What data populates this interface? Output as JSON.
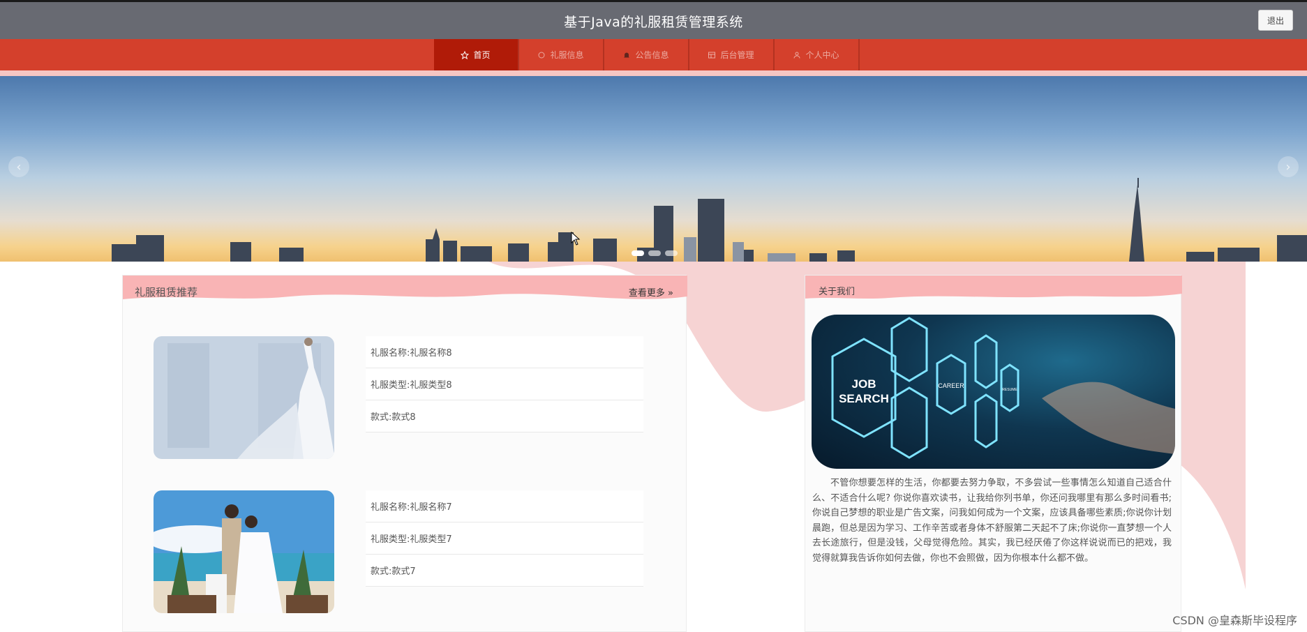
{
  "header": {
    "title": "基于Java的礼服租赁管理系统",
    "logout_label": "退出"
  },
  "nav": {
    "items": [
      {
        "label": "首页",
        "icon": "star-icon"
      },
      {
        "label": "礼服信息",
        "icon": "circle-icon"
      },
      {
        "label": "公告信息",
        "icon": "bell-icon"
      },
      {
        "label": "后台管理",
        "icon": "grid-icon"
      },
      {
        "label": "个人中心",
        "icon": "user-icon"
      }
    ]
  },
  "banner": {
    "prev_symbol": "‹",
    "next_symbol": "›",
    "slide_count": 3,
    "active_slide": 1
  },
  "recommend": {
    "title": "礼服租赁推荐",
    "more_label": "查看更多 »",
    "items": [
      {
        "name": "礼服名称:礼服名称8",
        "type": "礼服类型:礼服类型8",
        "style": "款式:款式8"
      },
      {
        "name": "礼服名称:礼服名称7",
        "type": "礼服类型:礼服类型7",
        "style": "款式:款式7"
      }
    ]
  },
  "about": {
    "title": "关于我们",
    "image_labels": {
      "job": "JOB",
      "search": "SEARCH",
      "career": "CAREER",
      "resume": "RESUME"
    },
    "text": "不管你想要怎样的生活，你都要去努力争取，不多尝试一些事情怎么知道自己适合什么、不适合什么呢? 你说你喜欢读书，让我给你列书单，你还问我哪里有那么多时间看书;你说自己梦想的职业是广告文案，问我如何成为一个文案，应该具备哪些素质;你说你计划晨跑，但总是因为学习、工作辛苦或者身体不舒服第二天起不了床;你说你一直梦想一个人去长途旅行，但是没钱，父母觉得危险。其实，我已经厌倦了你这样说说而已的把戏，我觉得就算我告诉你如何去做，你也不会照做，因为你根本什么都不做。"
  },
  "watermark": "CSDN @皇森斯毕设程序",
  "colors": {
    "header_bg": "#686a72",
    "nav_bg": "#d4402c",
    "nav_active": "#b01b08",
    "panel_head_pink": "#f9b4b5",
    "wave_pink": "#f6d3d3"
  }
}
